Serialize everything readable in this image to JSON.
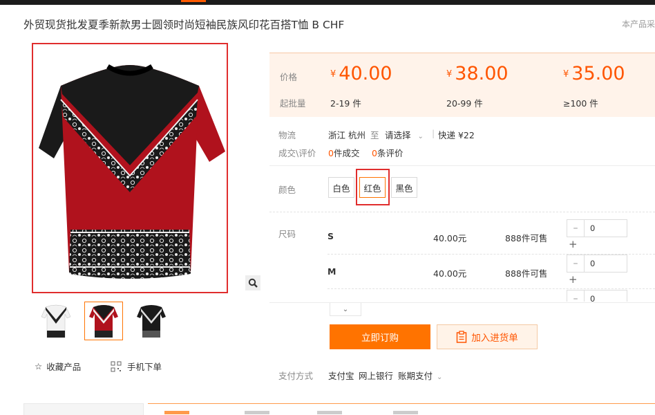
{
  "product": {
    "title": "外贸现货批发夏季新款男士圆领时尚短袖民族风印花百搭T恤 B CHF",
    "note": "本产品采"
  },
  "pricing": {
    "price_label": "价格",
    "moq_label": "起批量",
    "currency": "¥",
    "tiers": [
      {
        "price": "40.00",
        "range": "2-19 件"
      },
      {
        "price": "38.00",
        "range": "20-99 件"
      },
      {
        "price": "35.00",
        "range": "≥100 件"
      }
    ]
  },
  "logistics": {
    "label": "物流",
    "origin": "浙江 杭州",
    "to": "至",
    "dest": "请选择",
    "express": "快递 ¥22"
  },
  "deals": {
    "label": "成交\\评价",
    "deals_count": "0",
    "deals_text": "件成交",
    "reviews_count": "0",
    "reviews_text": "条评价"
  },
  "color": {
    "label": "颜色",
    "options": [
      "白色",
      "红色",
      "黑色"
    ],
    "selected": "红色"
  },
  "size": {
    "label": "尺码",
    "rows": [
      {
        "size": "S",
        "price": "40.00元",
        "stock": "888件可售",
        "qty": "0"
      },
      {
        "size": "M",
        "price": "40.00元",
        "stock": "888件可售",
        "qty": "0"
      },
      {
        "qty": "0"
      }
    ]
  },
  "actions": {
    "buy_now": "立即订购",
    "add_to_list": "加入进货单",
    "favorite": "收藏产品",
    "mobile_order": "手机下单"
  },
  "payment": {
    "label": "支付方式",
    "methods": [
      "支付宝",
      "网上银行",
      "账期支付"
    ]
  },
  "colors": {
    "accent": "#ff7300",
    "price": "#ff5500",
    "highlight": "#e02d2d"
  }
}
